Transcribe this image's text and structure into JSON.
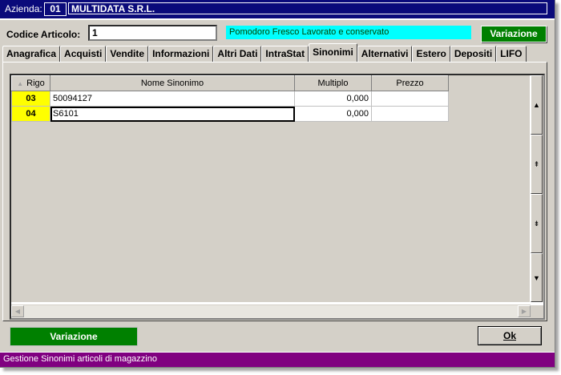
{
  "header": {
    "company_label": "Azienda:",
    "company_code": "01",
    "company_name": "MULTIDATA S.R.L."
  },
  "article": {
    "label": "Codice Articolo:",
    "code_value": "1",
    "description": "Pomodoro Fresco Lavorato e conservato",
    "top_button": "Variazione"
  },
  "tabs": [
    {
      "label": "Anagrafica",
      "active": false
    },
    {
      "label": "Acquisti",
      "active": false
    },
    {
      "label": "Vendite",
      "active": false
    },
    {
      "label": "Informazioni",
      "active": false
    },
    {
      "label": "Altri Dati",
      "active": false
    },
    {
      "label": "IntraStat",
      "active": false
    },
    {
      "label": "Sinonimi",
      "active": true
    },
    {
      "label": "Alternativi",
      "active": false
    },
    {
      "label": "Estero",
      "active": false
    },
    {
      "label": "Depositi",
      "active": false
    },
    {
      "label": "LIFO",
      "active": false
    }
  ],
  "grid": {
    "columns": [
      "Rigo",
      "Nome Sinonimo",
      "Multiplo",
      "Prezzo"
    ],
    "rows": [
      {
        "rigo": "03",
        "nome": "50094127",
        "multiplo": "0,000",
        "prezzo": ""
      },
      {
        "rigo": "04",
        "nome": "S6101",
        "multiplo": "0,000",
        "prezzo": ""
      }
    ]
  },
  "footer": {
    "variazione_button": "Variazione",
    "ok_button": "Ok",
    "status": "Gestione Sinonimi articoli di magazzino"
  },
  "colors": {
    "header_bg": "#0a0a7a",
    "description_bg": "#00ffff",
    "button_green": "#008000",
    "rigo_bg": "#ffff00",
    "status_bg": "#800080"
  }
}
